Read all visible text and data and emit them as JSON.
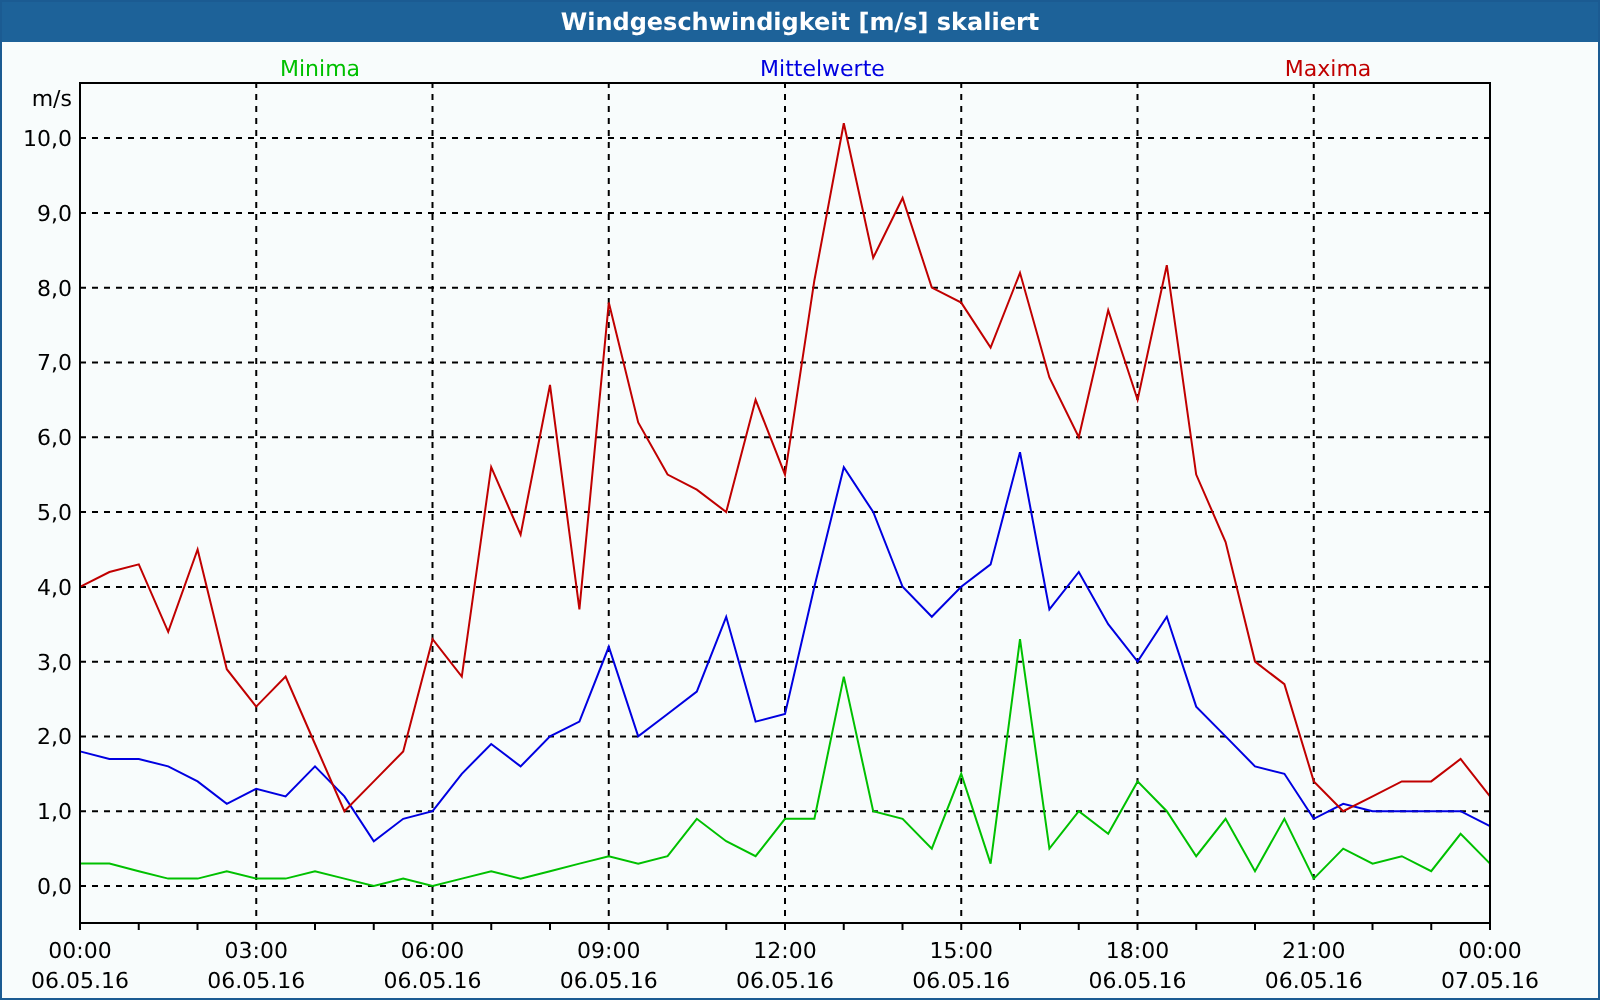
{
  "window": {
    "title": "Windgeschwindigkeit [m/s] skaliert"
  },
  "chart": {
    "chart_data": {
      "type": "line",
      "grid": true,
      "ylabel": "m/s",
      "ylim": [
        -0.48,
        10.75
      ],
      "yticks": [
        {
          "value": 0,
          "label": "0,0"
        },
        {
          "value": 1,
          "label": "1,0"
        },
        {
          "value": 2,
          "label": "2,0"
        },
        {
          "value": 3,
          "label": "3,0"
        },
        {
          "value": 4,
          "label": "4,0"
        },
        {
          "value": 5,
          "label": "5,0"
        },
        {
          "value": 6,
          "label": "6,0"
        },
        {
          "value": 7,
          "label": "7,0"
        },
        {
          "value": 8,
          "label": "8,0"
        },
        {
          "value": 9,
          "label": "9,0"
        },
        {
          "value": 10,
          "label": "10,0"
        }
      ],
      "categories": [
        "00:00 06.05.16",
        null,
        null,
        null,
        null,
        null,
        "03:00 06.05.16",
        null,
        null,
        null,
        null,
        null,
        "06:00 06.05.16",
        null,
        null,
        null,
        null,
        null,
        "09:00 06.05.16",
        null,
        null,
        null,
        null,
        null,
        "12:00 06.05.16",
        null,
        null,
        null,
        null,
        null,
        "15:00 06.05.16",
        null,
        null,
        null,
        null,
        null,
        "18:00 06.05.16",
        null,
        null,
        null,
        null,
        null,
        "21:00 06.05.16",
        null,
        null,
        null,
        null,
        null,
        "00:00 07.05.16"
      ],
      "series": [
        {
          "name": "Minima",
          "color": "#00c000",
          "values": [
            0.3,
            0.3,
            0.2,
            0.1,
            0.1,
            0.2,
            0.1,
            0.1,
            0.2,
            0.1,
            0.0,
            0.1,
            0.0,
            0.1,
            0.2,
            0.1,
            0.2,
            0.3,
            0.4,
            0.3,
            0.4,
            0.9,
            0.6,
            0.4,
            0.9,
            0.9,
            2.8,
            1.0,
            0.9,
            0.5,
            1.5,
            0.3,
            3.3,
            0.5,
            1.0,
            0.7,
            1.4,
            1.0,
            0.4,
            0.9,
            0.2,
            0.9,
            0.1,
            0.5,
            0.3,
            0.4,
            0.2,
            0.7,
            0.3
          ]
        },
        {
          "name": "Mittelwerte",
          "color": "#0000e0",
          "values": [
            1.8,
            1.7,
            1.7,
            1.6,
            1.4,
            1.1,
            1.3,
            1.2,
            1.6,
            1.2,
            0.6,
            0.9,
            1.0,
            1.5,
            1.9,
            1.6,
            2.0,
            2.2,
            3.2,
            2.0,
            2.3,
            2.6,
            3.6,
            2.2,
            2.3,
            4.0,
            5.6,
            5.0,
            4.0,
            3.6,
            4.0,
            4.3,
            5.8,
            3.7,
            4.2,
            3.5,
            3.0,
            3.6,
            2.4,
            2.0,
            1.6,
            1.5,
            0.9,
            1.1,
            1.0,
            1.0,
            1.0,
            1.0,
            0.8
          ]
        },
        {
          "name": "Maxima",
          "color": "#c00000",
          "values": [
            4.0,
            4.2,
            4.3,
            3.4,
            4.5,
            2.9,
            2.4,
            2.8,
            1.9,
            1.0,
            1.4,
            1.8,
            3.3,
            2.8,
            5.6,
            4.7,
            6.7,
            3.7,
            7.8,
            6.2,
            5.5,
            5.3,
            5.0,
            6.5,
            5.5,
            8.1,
            10.2,
            8.4,
            9.2,
            8.0,
            7.8,
            7.2,
            8.2,
            6.8,
            6.0,
            7.7,
            6.5,
            8.3,
            5.5,
            4.6,
            3.0,
            2.7,
            1.4,
            1.0,
            1.2,
            1.4,
            1.4,
            1.7,
            1.2
          ]
        }
      ]
    }
  }
}
